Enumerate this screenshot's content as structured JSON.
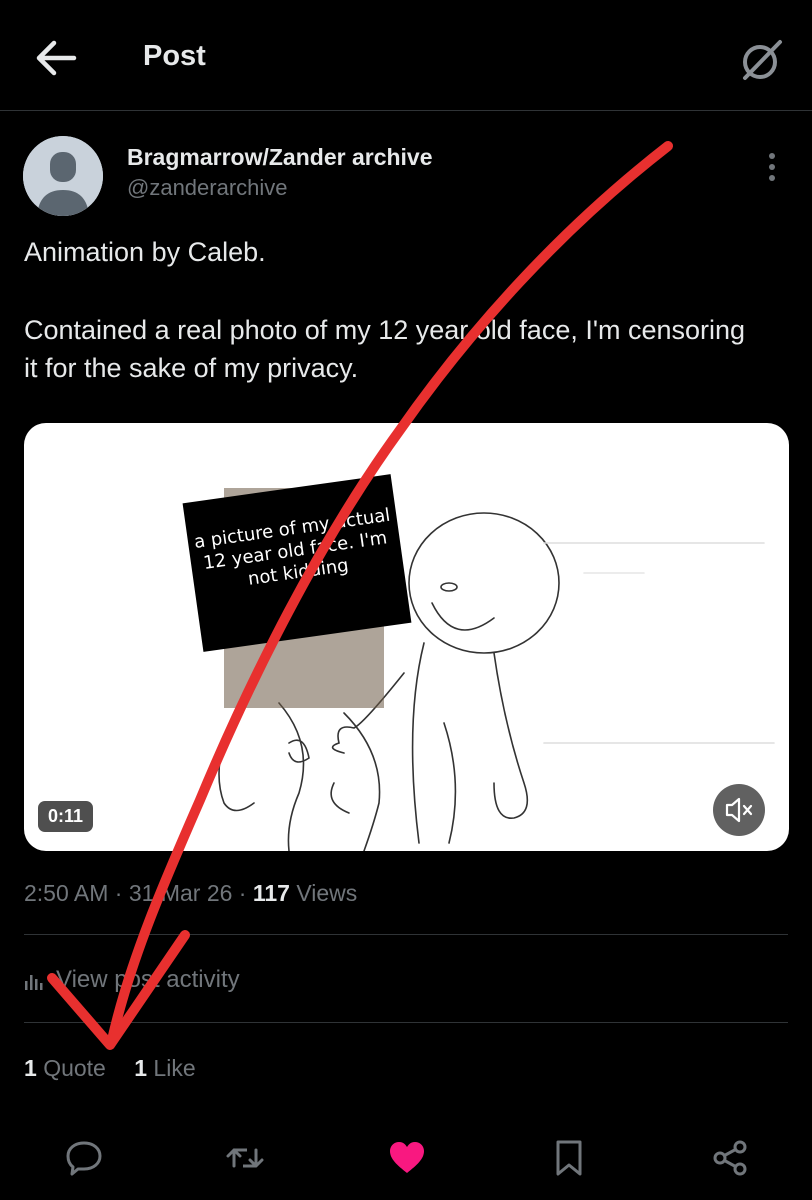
{
  "header": {
    "title": "Post",
    "back_icon": "arrow-left-icon",
    "right_icon": "grok-icon"
  },
  "author": {
    "display_name": "Bragmarrow/Zander archive",
    "handle": "@zanderarchive",
    "avatar_icon": "default-avatar-icon"
  },
  "post": {
    "text_line_1": "Animation by Caleb.",
    "text_line_2": "Contained a real photo of my 12 year old face, I'm censoring it for the sake of my privacy.",
    "media": {
      "duration": "0:11",
      "overlay_text": "a picture of my actual 12 year old face. I'm not kidding",
      "muted": true
    }
  },
  "meta": {
    "time": "2:50 AM",
    "date": "31 Mar 26",
    "views_count": "117",
    "views_label": "Views",
    "separator": "·"
  },
  "activity": {
    "label": "View post activity"
  },
  "stats": {
    "quote_count": "1",
    "quote_label": "Quote",
    "like_count": "1",
    "like_label": "Like"
  },
  "actions": {
    "reply_icon": "reply-icon",
    "repost_icon": "repost-icon",
    "like_icon": "heart-icon",
    "bookmark_icon": "bookmark-icon",
    "share_icon": "share-icon",
    "liked": true
  },
  "colors": {
    "background": "#000000",
    "text": "#e7e9ea",
    "muted": "#71767b",
    "divider": "#2f3336",
    "like": "#f91880",
    "annotation": "#e8302f"
  }
}
